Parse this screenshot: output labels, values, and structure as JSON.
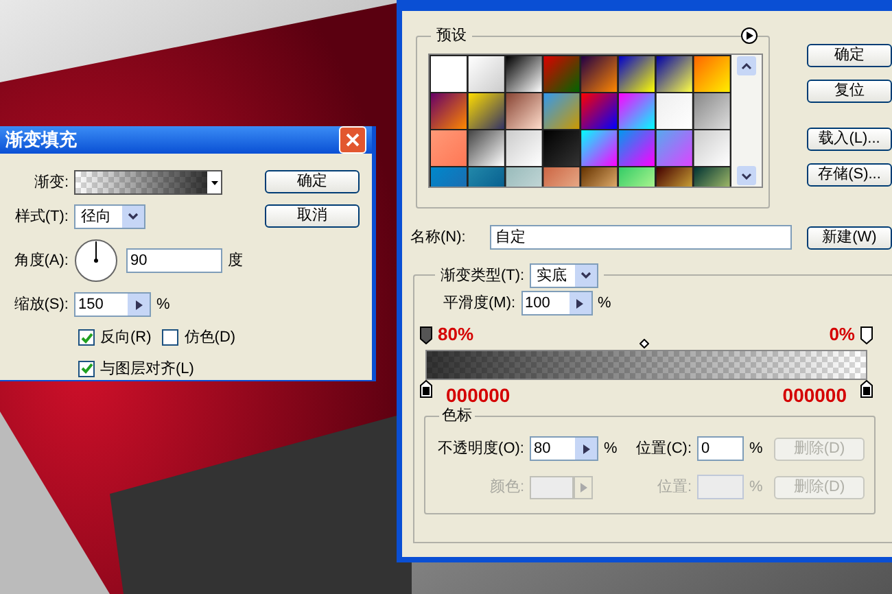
{
  "fill_dialog": {
    "title": "渐变填充",
    "gradient_label": "渐变:",
    "style_label": "样式(T):",
    "style_value": "径向",
    "angle_label": "角度(A):",
    "angle_value": "90",
    "angle_unit": "度",
    "scale_label": "缩放(S):",
    "scale_value": "150",
    "scale_unit": "%",
    "checkboxes": [
      {
        "label": "反向(R)",
        "checked": true
      },
      {
        "label": "仿色(D)",
        "checked": false
      },
      {
        "label": "与图层对齐(L)",
        "checked": true
      }
    ],
    "buttons": [
      "确定",
      "取消"
    ]
  },
  "editor": {
    "presets_label": "预设",
    "buttons": [
      "确定",
      "复位",
      "载入(L)...",
      "存储(S)..."
    ],
    "name_label": "名称(N):",
    "name_value": "自定",
    "new_button": "新建(W)",
    "type_label": "渐变类型(T):",
    "type_value": "实底",
    "smooth_label": "平滑度(M):",
    "smooth_value": "100",
    "smooth_unit": "%",
    "opacity_stops": [
      {
        "annotation": "80%",
        "selected": true
      },
      {
        "annotation": "0%",
        "selected": false
      }
    ],
    "color_stops": [
      {
        "annotation": "000000"
      },
      {
        "annotation": "000000"
      }
    ],
    "stops_group": {
      "title": "色标",
      "rows": [
        {
          "kind": "opacity",
          "label": "不透明度(O):",
          "value": "80",
          "unit": "%",
          "location_label": "位置(C):",
          "location_value": "0",
          "location_unit": "%",
          "delete": "删除(D)",
          "disabled": false,
          "delete_disabled": true
        },
        {
          "kind": "color",
          "label": "颜色:",
          "location_label": "位置:",
          "location_unit": "%",
          "delete": "删除(D)",
          "disabled": true,
          "delete_disabled": true
        }
      ]
    }
  }
}
